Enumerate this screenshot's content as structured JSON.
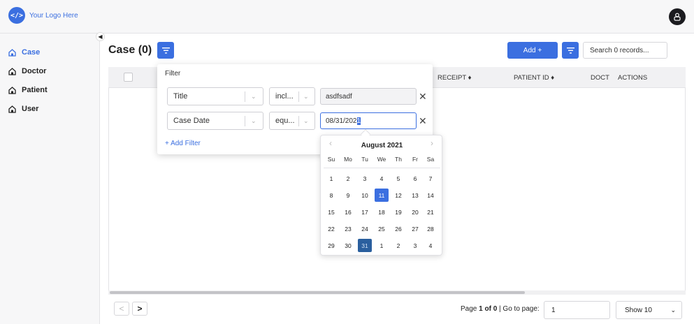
{
  "header": {
    "logo_badge": "</>",
    "logo_text": "Your Logo Here"
  },
  "sidebar": {
    "items": [
      {
        "label": "Case",
        "active": true
      },
      {
        "label": "Doctor"
      },
      {
        "label": "Patient"
      },
      {
        "label": "User"
      }
    ]
  },
  "page": {
    "title": "Case (0)",
    "add_label": "Add +",
    "search_placeholder": "Search 0 records..."
  },
  "table": {
    "columns": [
      "RECEIPT ♦",
      "PATIENT ID ♦",
      "DOCT",
      "ACTIONS"
    ]
  },
  "filter": {
    "label": "Filter",
    "rows": [
      {
        "field": "Title",
        "op": "incl...",
        "value": "asdfsadf"
      },
      {
        "field": "Case Date",
        "op": "equ...",
        "value_prefix": "08/31/202",
        "value_selected": "1"
      }
    ],
    "add_label": "+ Add Filter"
  },
  "calendar": {
    "month_label": "August 2021",
    "dow": [
      "Su",
      "Mo",
      "Tu",
      "We",
      "Th",
      "Fr",
      "Sa"
    ],
    "weeks": [
      [
        "1",
        "2",
        "3",
        "4",
        "5",
        "6",
        "7"
      ],
      [
        "8",
        "9",
        "10",
        "11",
        "12",
        "13",
        "14"
      ],
      [
        "15",
        "16",
        "17",
        "18",
        "19",
        "20",
        "21"
      ],
      [
        "22",
        "23",
        "24",
        "25",
        "26",
        "27",
        "28"
      ],
      [
        "29",
        "30",
        "31",
        "1",
        "2",
        "3",
        "4"
      ]
    ],
    "today": "11",
    "selected": "31"
  },
  "pagination": {
    "prev": "<",
    "next": ">",
    "page_prefix": "Page ",
    "page_of": "1 of 0",
    "goto_label": " | Go to page:",
    "goto_value": "1",
    "show_value": "Show 10"
  },
  "colors": {
    "accent": "#3b6fe0",
    "selected_day": "#2a5f9e"
  }
}
